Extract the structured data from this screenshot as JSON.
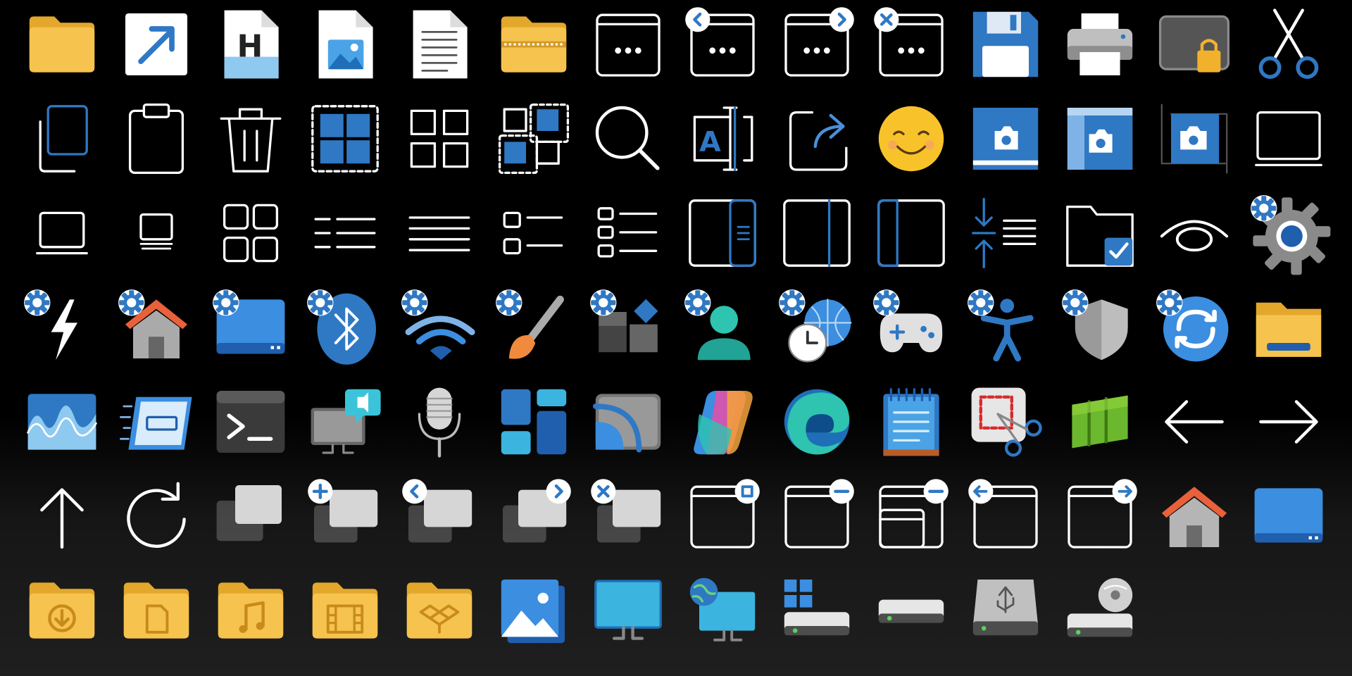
{
  "title": "",
  "palette": {
    "background": "#000000",
    "accent": "#2F78C4",
    "folder_yellow": "#F6C34E",
    "line_white": "#FFFFFF"
  },
  "icon_grid": {
    "rows": [
      [
        "folder-icon",
        "shortcut-arrow-icon",
        "html-file-icon",
        "image-file-icon",
        "text-document-icon",
        "zip-folder-icon",
        "window-more-icon",
        "window-back-more-icon",
        "window-forward-more-icon",
        "window-close-more-icon",
        "floppy-save-icon",
        "printer-icon",
        "locked-drive-icon",
        "scissors-icon"
      ],
      [
        "copy-icon",
        "clipboard-icon",
        "trash-bin-icon",
        "select-all-icon",
        "grid-view-icon",
        "partial-select-icon",
        "search-magnifier-icon",
        "rename-text-icon",
        "share-export-icon",
        "smiley-emoji-icon",
        "screenshot-window-icon",
        "screenshot-region-icon",
        "screenshot-crop-icon",
        "monitor-outline-icon"
      ],
      [
        "small-monitor-icon",
        "tiny-monitor-icon",
        "tiles-view-icon",
        "compact-list-icon",
        "lines-list-icon",
        "content-list-icon",
        "details-list-icon",
        "details-pane-icon",
        "preview-pane-icon",
        "navigation-pane-icon",
        "compact-spacing-icon",
        "folder-checkbox-icon",
        "eye-view-icon",
        "settings-gear-icon"
      ],
      [
        "settings-power-icon",
        "settings-home-icon",
        "settings-system-icon",
        "settings-bluetooth-icon",
        "settings-network-icon",
        "settings-personalization-icon",
        "settings-apps-icon",
        "settings-accounts-icon",
        "settings-time-language-icon",
        "settings-gaming-icon",
        "settings-accessibility-icon",
        "settings-privacy-shield-icon",
        "settings-windows-update-icon",
        "file-explorer-icon"
      ],
      [
        "activity-monitor-icon",
        "card-device-icon",
        "terminal-icon",
        "feedback-hub-icon",
        "microphone-icon",
        "widgets-icon",
        "cast-icon",
        "copilot-icon",
        "edge-browser-icon",
        "notepad-icon",
        "snipping-tool-icon",
        "stacked-panels-icon",
        "arrow-left-icon",
        "arrow-right-icon"
      ],
      [
        "arrow-up-icon",
        "refresh-icon",
        "restore-windows-icon",
        "new-window-icon",
        "window-back-icon",
        "window-forward-icon",
        "window-close-icon",
        "window-maximize-icon",
        "window-minimize-icon",
        "windows-minimize-stack-icon",
        "window-arrow-left-icon",
        "window-arrow-right-icon",
        "home-icon",
        "desktop-icon"
      ],
      [
        "downloads-folder-icon",
        "documents-folder-icon",
        "music-folder-icon",
        "videos-folder-icon",
        "dropbox-folder-icon",
        "pictures-icon",
        "monitor-icon",
        "network-monitor-icon",
        "windows-drive-icon",
        "hard-drive-icon",
        "usb-drive-icon",
        "dvd-drive-icon"
      ]
    ]
  }
}
